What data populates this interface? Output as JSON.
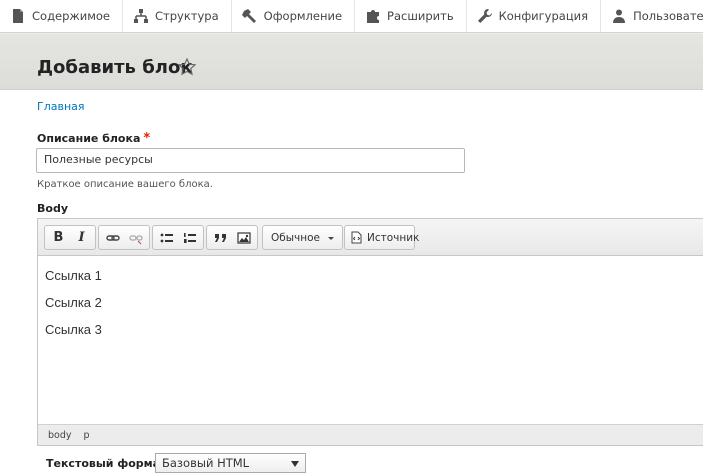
{
  "toolbar": {
    "items": [
      {
        "label": "Содержимое",
        "icon": "document-icon"
      },
      {
        "label": "Структура",
        "icon": "sitemap-icon"
      },
      {
        "label": "Оформление",
        "icon": "wrench-brush-icon"
      },
      {
        "label": "Расширить",
        "icon": "puzzle-icon"
      },
      {
        "label": "Конфигурация",
        "icon": "wrench-icon"
      },
      {
        "label": "Пользователи",
        "icon": "users-icon"
      }
    ]
  },
  "page": {
    "title": "Добавить блок",
    "breadcrumb": "Главная"
  },
  "form": {
    "description_label": "Описание блока",
    "required_mark": "*",
    "description_value": "Полезные ресурсы",
    "description_help": "Краткое описание вашего блока.",
    "body_label": "Body"
  },
  "editor": {
    "bold": "B",
    "italic": "I",
    "format_combo": "Обычное",
    "source_button": "Источник",
    "lines": [
      "Ссылка 1",
      "Ссылка 2",
      "Ссылка 3"
    ],
    "path": [
      "body",
      "p"
    ]
  },
  "text_format": {
    "label": "Текстовый формат",
    "value": "Базовый HTML"
  }
}
